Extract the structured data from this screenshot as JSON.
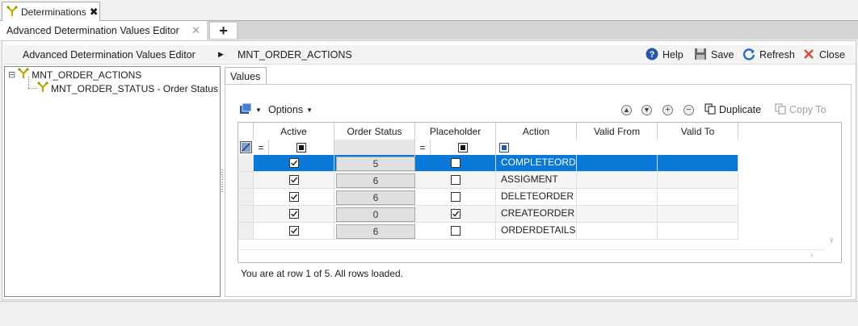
{
  "doc_tab": {
    "label": "Determinations",
    "close": "✖"
  },
  "editor_tab": {
    "label": "Advanced Determination Values Editor",
    "close": "✕",
    "add": "+"
  },
  "breadcrumb": {
    "root": "Advanced Determination Values Editor",
    "separator": "▶",
    "current": "MNT_ORDER_ACTIONS"
  },
  "toolbar": {
    "help": "Help",
    "save": "Save",
    "refresh": "Refresh",
    "close": "Close"
  },
  "tree": {
    "root": "MNT_ORDER_ACTIONS",
    "expander": "⊟",
    "child": "MNT_ORDER_STATUS - Order Status"
  },
  "values_tab": {
    "label": "Values"
  },
  "grid_toolbar": {
    "options": "Options",
    "duplicate": "Duplicate",
    "copy_to": "Copy To"
  },
  "grid": {
    "columns": [
      "Active",
      "Order Status",
      "Placeholder",
      "Action",
      "Valid From",
      "Valid To"
    ],
    "filter_eq": "=",
    "rows": [
      {
        "active": true,
        "status": "5",
        "placeholder": false,
        "action": "COMPLETEORD",
        "selected": true
      },
      {
        "active": true,
        "status": "6",
        "placeholder": false,
        "action": "ASSIGMENT",
        "selected": false
      },
      {
        "active": true,
        "status": "6",
        "placeholder": false,
        "action": "DELETEORDER",
        "selected": false
      },
      {
        "active": true,
        "status": "0",
        "placeholder": true,
        "action": "CREATEORDER",
        "selected": false
      },
      {
        "active": true,
        "status": "6",
        "placeholder": false,
        "action": "ORDERDETAILS",
        "selected": false
      }
    ]
  },
  "status_text": "You are at row 1 of 5. All rows loaded.",
  "colors": {
    "selection": "#0a78d7",
    "accent": "#2b56a8"
  }
}
